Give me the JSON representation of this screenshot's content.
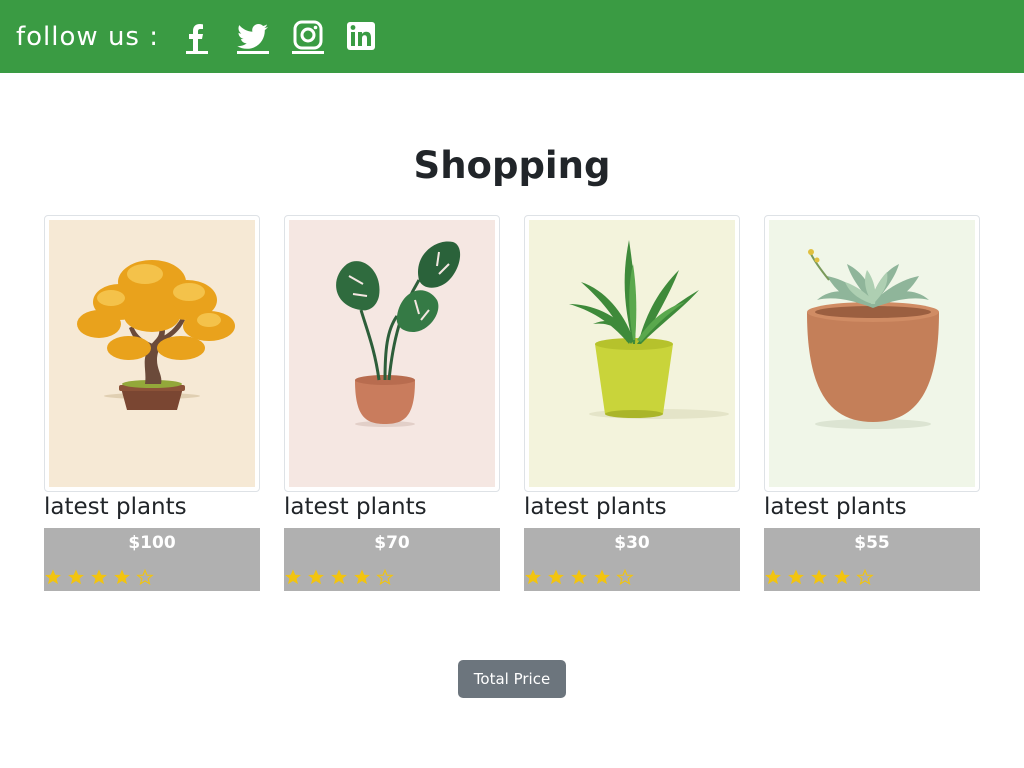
{
  "header": {
    "follow_label": "follow us :",
    "background_color": "#3a9b43",
    "social_icons": [
      "facebook-icon",
      "twitter-icon",
      "instagram-icon",
      "linkedin-icon"
    ]
  },
  "page_title": "Shopping",
  "products": [
    {
      "title": "latest plants",
      "price": "$100",
      "rating": 4,
      "max_rating": 5,
      "image": "yellow bonsai tree"
    },
    {
      "title": "latest plants",
      "price": "$70",
      "rating": 4,
      "max_rating": 5,
      "image": "monstera in terracotta pot"
    },
    {
      "title": "latest plants",
      "price": "$30",
      "rating": 4,
      "max_rating": 5,
      "image": "dracaena in lime pot"
    },
    {
      "title": "latest plants",
      "price": "$55",
      "rating": 4,
      "max_rating": 5,
      "image": "succulent in clay pot"
    }
  ],
  "total_button_label": "Total Price",
  "colors": {
    "star": "#f2c40f",
    "info_panel": "#b0b0b0",
    "button": "#6c757d"
  }
}
